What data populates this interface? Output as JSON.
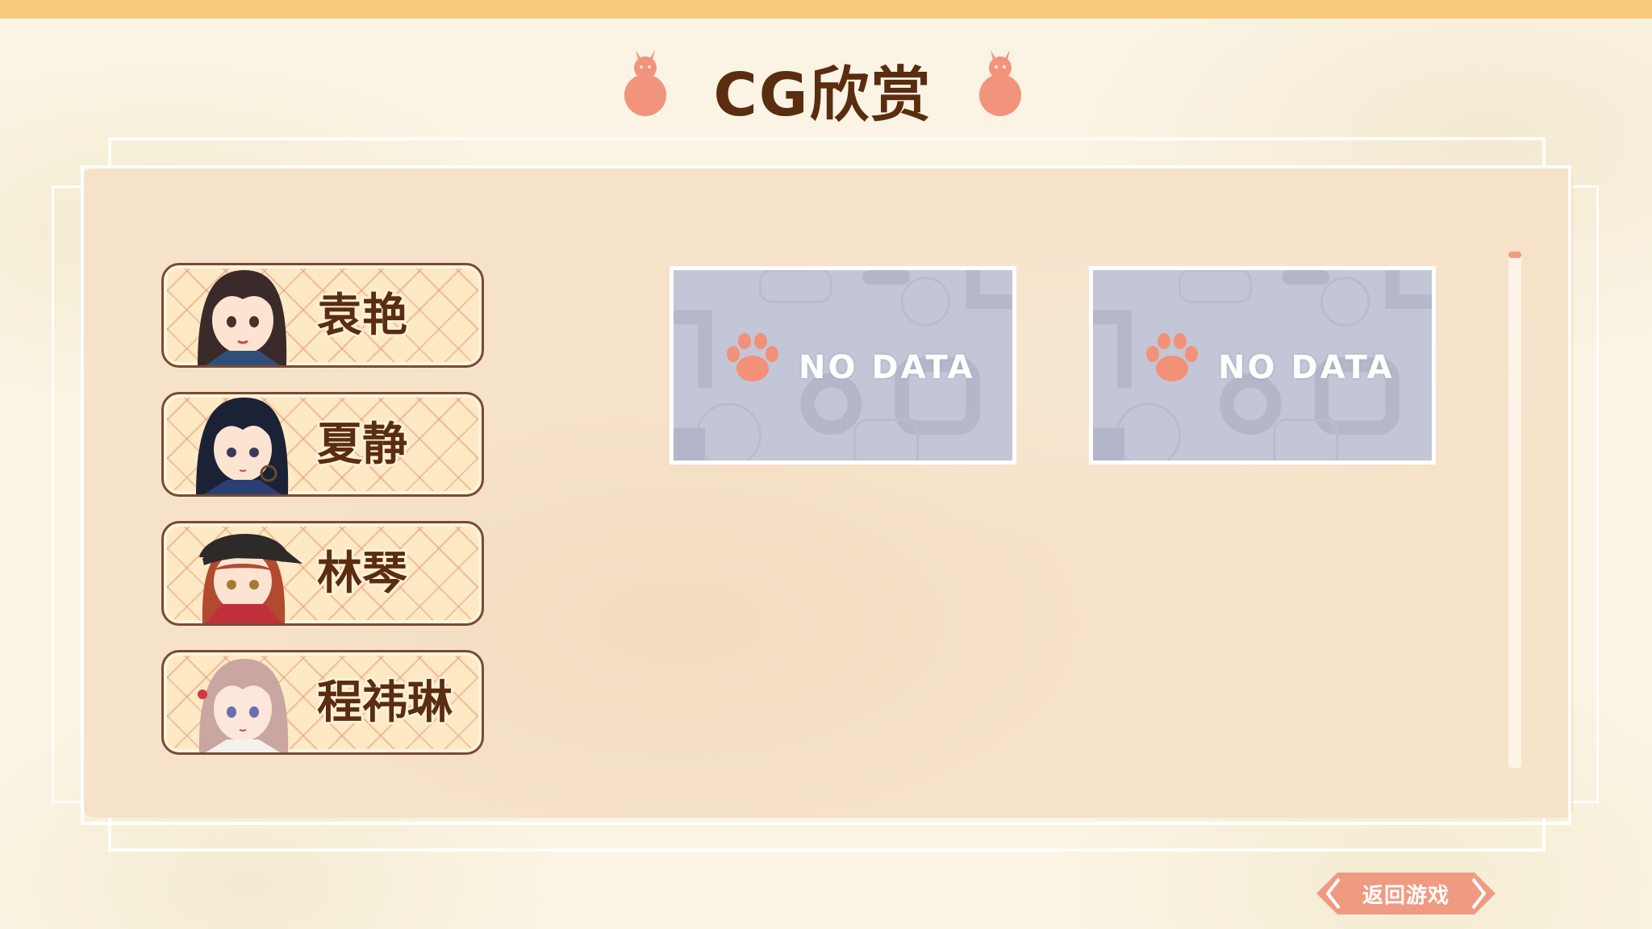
{
  "screen": {
    "title": "CG欣赏"
  },
  "characters": [
    {
      "name": "袁艳",
      "hair": "#3a2a2a",
      "accent": "#2f4f7a"
    },
    {
      "name": "夏静",
      "hair": "#1b2236",
      "accent": "#2c3f73"
    },
    {
      "name": "林琴",
      "hair": "#b24a2f",
      "accent": "#c0303a"
    },
    {
      "name": "程祎琳",
      "hair": "#c9a6a0",
      "accent": "#e8e0da"
    }
  ],
  "cg_slots": [
    {
      "label": "NO DATA"
    },
    {
      "label": "NO DATA"
    }
  ],
  "scrollbar": {
    "position": 0
  },
  "return_button": {
    "label": "返回游戏"
  },
  "colors": {
    "top_strip": "#f7c97b",
    "title_text": "#5a2d10",
    "ornament": "#f2937c",
    "panel": "#f6e2c9",
    "slot_bg": "#c3c6d6",
    "paw": "#f39178",
    "return_button": "#f19a82"
  }
}
